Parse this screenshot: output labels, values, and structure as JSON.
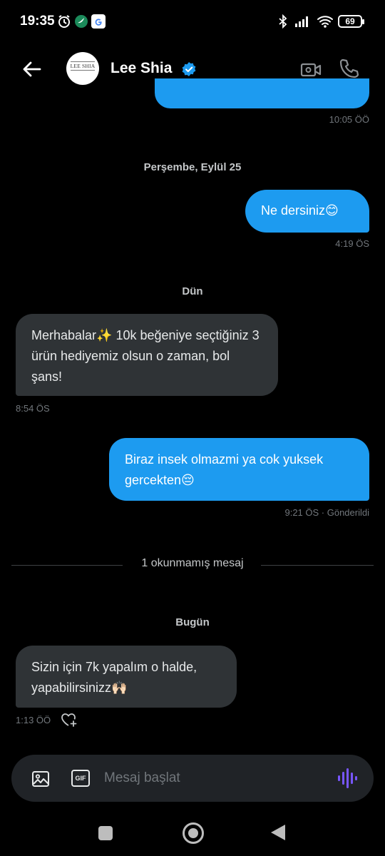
{
  "status_bar": {
    "time": "19:35",
    "battery": "69",
    "icons": [
      "alarm-icon",
      "app-notification-icon",
      "google-icon",
      "bluetooth-icon",
      "signal-icon",
      "wifi-icon",
      "battery-icon"
    ]
  },
  "header": {
    "contact_name": "Lee Shia",
    "avatar_text": "LEE SHIA",
    "verified": true
  },
  "conversation": {
    "first_timestamp": "10:05 ÖÖ",
    "groups": [
      {
        "date": "Perşembe, Eylül 25",
        "messages": [
          {
            "direction": "out",
            "text": "Ne dersiniz😊",
            "time": "4:19 ÖS"
          }
        ]
      },
      {
        "date": "Dün",
        "messages": [
          {
            "direction": "in",
            "text": "Merhabalar✨ 10k beğeniye seçtiğiniz 3 ürün hediyemiz olsun o zaman, bol şans!",
            "time": "8:54 ÖS"
          },
          {
            "direction": "out",
            "text": "Biraz insek olmazmi ya cok yuksek gercekten😔",
            "time": "9:21 ÖS · Gönderildi"
          }
        ]
      },
      {
        "date": "Bugün",
        "messages": [
          {
            "direction": "in",
            "text": "Sizin için 7k yapalım o halde, yapabilirsinizz🙌🏻",
            "time": "1:13 ÖÖ"
          }
        ]
      }
    ],
    "unread_divider": "1 okunmamış mesaj"
  },
  "composer": {
    "placeholder": "Mesaj başlat",
    "gif_label": "GIF"
  },
  "colors": {
    "accent": "#1d9bf0",
    "incoming_bubble": "#2f3336",
    "background": "#000000",
    "muted_text": "#71767b",
    "voice_icon": "#7856ff"
  }
}
